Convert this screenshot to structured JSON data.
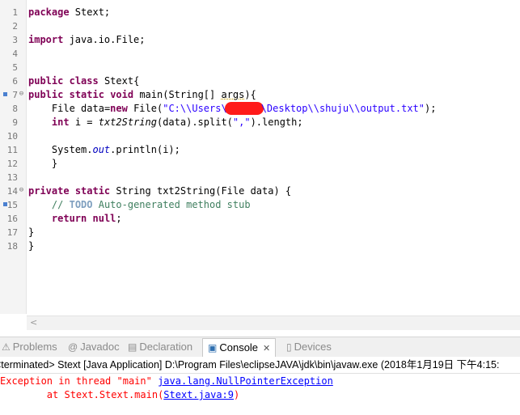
{
  "editor": {
    "line_numbers": [
      "1",
      "2",
      "3",
      "4",
      "5",
      "6",
      "7",
      "8",
      "9",
      "10",
      "11",
      "12",
      "13",
      "14",
      "15",
      "16",
      "17",
      "18"
    ],
    "line1": {
      "kw": "package",
      "rest": " Stext;"
    },
    "line3": {
      "kw": "import",
      "rest": " java.io.File;"
    },
    "line6": {
      "kw1": "public",
      "kw2": "class",
      "rest": " Stext{"
    },
    "line7": {
      "kw1": "public",
      "kw2": "static",
      "kw3": "void",
      "mid": " main(String[] ",
      "param": "args",
      "end": "){"
    },
    "line8": {
      "indent": "    File ",
      "var": "data",
      "eq": "=",
      "kw": "new",
      "mid": " File(",
      "str1": "\"C:\\\\Users\\",
      "str2": "\\Desktop\\\\shuju\\\\output.txt\"",
      "end": ");"
    },
    "line9": {
      "indent": "    ",
      "kw": "int",
      "mid": " i = ",
      "call": "txt2String",
      "mid2": "(data).split(",
      "str": "\",\"",
      "end": ").length;"
    },
    "line11": {
      "indent": "    System.",
      "field": "out",
      "rest": ".println(i);"
    },
    "line12": {
      "text": "    }"
    },
    "line14": {
      "kw1": "private",
      "kw2": "static",
      "rest": " String txt2String(File data) {"
    },
    "line15": {
      "indent": "    ",
      "comment1": "// ",
      "todo": "TODO",
      "comment2": " Auto-generated method stub"
    },
    "line16": {
      "indent": "    ",
      "kw1": "return",
      "kw2": "null",
      "end": ";"
    },
    "line17": {
      "text": "}"
    },
    "line18": {
      "text": "}"
    }
  },
  "tabs": [
    {
      "label": "Problems",
      "icon": "problems-icon",
      "glyph": "⚠"
    },
    {
      "label": "Javadoc",
      "icon": "at-icon",
      "glyph": "@"
    },
    {
      "label": "Declaration",
      "icon": "declaration-icon",
      "glyph": "▤"
    },
    {
      "label": "Console",
      "icon": "console-icon",
      "glyph": "▣",
      "close": "✕"
    },
    {
      "label": "Devices",
      "icon": "device-icon",
      "glyph": "▯"
    }
  ],
  "console": {
    "status": "<terminated> Stext [Java Application] D:\\Program Files\\eclipseJAVA\\jdk\\bin\\javaw.exe (2018年1月19日 下午4:15:",
    "exception_prefix": "Exception in thread \"main\" ",
    "exception_link": "java.lang.NullPointerException",
    "at_prefix": "        at Stext.Stext.main(",
    "at_link": "Stext.java:9",
    "at_suffix": ")"
  },
  "colors": {
    "keyword": "#7f0055",
    "string": "#2a00ff",
    "comment": "#3f7f5f",
    "error": "#ff0000",
    "link": "#0000ff"
  }
}
